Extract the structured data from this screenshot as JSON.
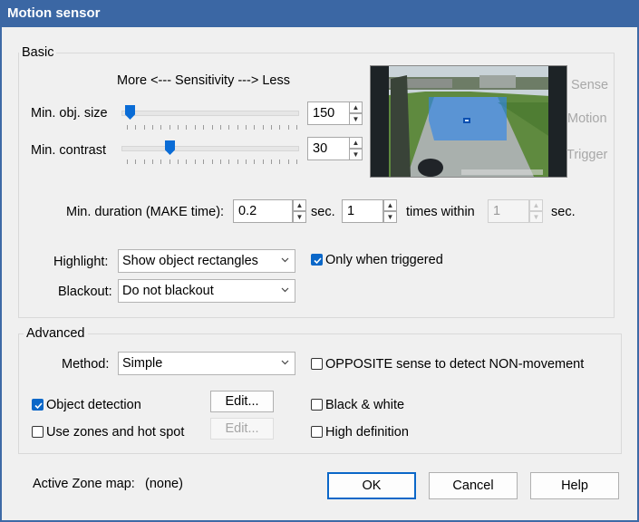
{
  "window": {
    "title": "Motion sensor"
  },
  "basic": {
    "legend": "Basic",
    "sensitivity_header": "More <--- Sensitivity ---> Less",
    "min_obj_size": {
      "label": "Min. obj. size",
      "value": "150"
    },
    "min_contrast": {
      "label": "Min. contrast",
      "value": "30"
    },
    "preview_labels": {
      "sense": "Sense",
      "motion": "Motion",
      "trigger": "Trigger"
    },
    "duration": {
      "label": "Min. duration (MAKE time):",
      "value": "0.2",
      "sec1": "sec.",
      "times_value": "1",
      "times_within": "times within",
      "within_value": "1",
      "sec2": "sec."
    },
    "highlight": {
      "label": "Highlight:",
      "value": "Show object rectangles"
    },
    "only_triggered": {
      "label": "Only when triggered",
      "checked": true
    },
    "blackout": {
      "label": "Blackout:",
      "value": "Do not blackout"
    }
  },
  "advanced": {
    "legend": "Advanced",
    "method": {
      "label": "Method:",
      "value": "Simple"
    },
    "opposite": {
      "label": "OPPOSITE sense to detect NON-movement",
      "checked": false
    },
    "object_detection": {
      "label": "Object detection",
      "checked": true,
      "edit_label": "Edit..."
    },
    "black_white": {
      "label": "Black & white",
      "checked": false
    },
    "use_zones": {
      "label": "Use zones and hot spot",
      "checked": false,
      "edit_label": "Edit..."
    },
    "high_def": {
      "label": "High definition",
      "checked": false
    }
  },
  "footer": {
    "active_zone_label": "Active Zone map:",
    "active_zone_value": "(none)",
    "ok": "OK",
    "cancel": "Cancel",
    "help": "Help"
  },
  "sliders": {
    "min_obj_size_level": 0.02,
    "min_contrast_level": 0.26
  },
  "colors": {
    "accent": "#0a67c8",
    "title_bar": "#3b67a4",
    "dialog_bg": "#f0f0f0"
  }
}
